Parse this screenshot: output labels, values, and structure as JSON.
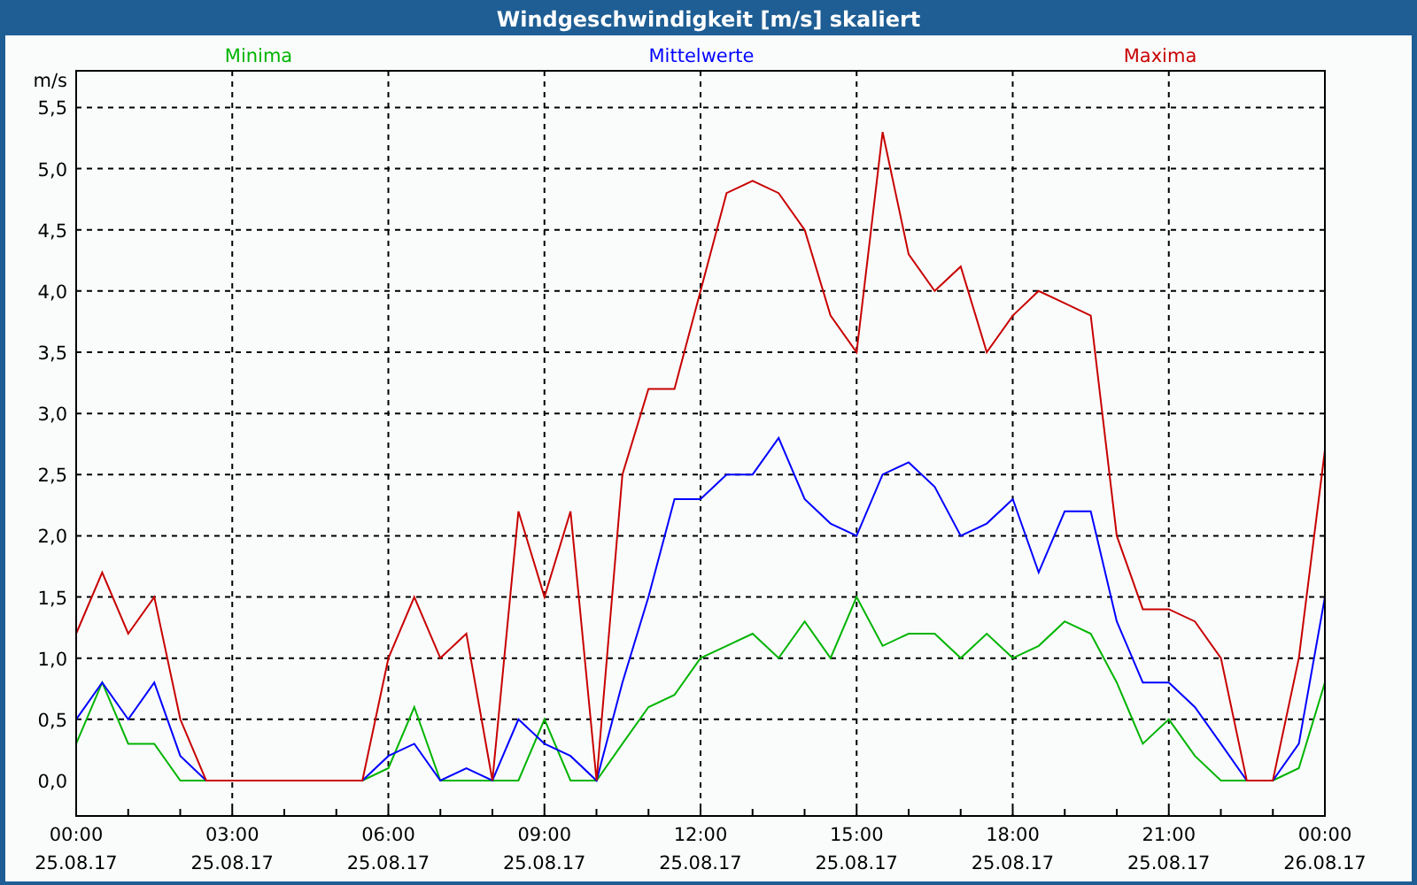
{
  "window": {
    "title": "Windgeschwindigkeit [m/s] skaliert"
  },
  "chart": {
    "chart_data": {
      "type": "line",
      "ylabel": "m/s",
      "categories": [
        "00:00\n25.08.17",
        null,
        null,
        null,
        null,
        null,
        "03:00\n25.08.17",
        null,
        null,
        null,
        null,
        null,
        "06:00\n25.08.17",
        null,
        null,
        null,
        null,
        null,
        "09:00\n25.08.17",
        null,
        null,
        null,
        null,
        null,
        "12:00\n25.08.17",
        null,
        null,
        null,
        null,
        null,
        "15:00\n25.08.17",
        null,
        null,
        null,
        null,
        null,
        "18:00\n25.08.17",
        null,
        null,
        null,
        null,
        null,
        "21:00\n25.08.17",
        null,
        null,
        null,
        null,
        null,
        "00:00\n26.08.17"
      ],
      "series": [
        {
          "name": "Minima",
          "color": "#00b400",
          "values": [
            0.3,
            0.8,
            0.3,
            0.3,
            0,
            0,
            0,
            0,
            0,
            0,
            0,
            0,
            0.1,
            0.6,
            0,
            0,
            0,
            0,
            0.5,
            0,
            0,
            0.3,
            0.6,
            0.7,
            1.0,
            1.1,
            1.2,
            1.0,
            1.3,
            1.0,
            1.5,
            1.1,
            1.2,
            1.2,
            1.0,
            1.2,
            1.0,
            1.1,
            1.3,
            1.2,
            0.8,
            0.3,
            0.5,
            0.2,
            0,
            0,
            0,
            0.1,
            0.8
          ]
        },
        {
          "name": "Mittelwerte",
          "color": "#0000ff",
          "values": [
            0.5,
            0.8,
            0.5,
            0.8,
            0.2,
            0,
            0,
            0,
            0,
            0,
            0,
            0,
            0.2,
            0.3,
            0,
            0.1,
            0,
            0.5,
            0.3,
            0.2,
            0,
            0.8,
            1.5,
            2.3,
            2.3,
            2.5,
            2.5,
            2.8,
            2.3,
            2.1,
            2.0,
            2.5,
            2.6,
            2.4,
            2.0,
            2.1,
            2.3,
            1.7,
            2.2,
            2.2,
            1.3,
            0.8,
            0.8,
            0.6,
            0.3,
            0,
            0,
            0.3,
            1.5
          ]
        },
        {
          "name": "Maxima",
          "color": "#c80000",
          "values": [
            1.2,
            1.7,
            1.2,
            1.5,
            0.5,
            0,
            0,
            0,
            0,
            0,
            0,
            0,
            1.0,
            1.5,
            1.0,
            1.2,
            0,
            2.2,
            1.5,
            2.2,
            0,
            2.5,
            3.2,
            3.2,
            4.0,
            4.8,
            4.9,
            4.8,
            4.5,
            3.8,
            3.5,
            5.3,
            4.3,
            4.0,
            4.2,
            3.5,
            3.8,
            4.0,
            3.9,
            3.8,
            2.0,
            1.4,
            1.4,
            1.3,
            1.0,
            0,
            0,
            1.0,
            2.7
          ]
        }
      ],
      "ylim": [
        -0.29,
        5.8
      ],
      "grid": true,
      "yticks": [
        {
          "value": 0,
          "label": "0,0"
        },
        {
          "value": 0.5,
          "label": "0,5"
        },
        {
          "value": 1,
          "label": "1,0"
        },
        {
          "value": 1.5,
          "label": "1,5"
        },
        {
          "value": 2,
          "label": "2,0"
        },
        {
          "value": 2.5,
          "label": "2,5"
        },
        {
          "value": 3,
          "label": "3,0"
        },
        {
          "value": 3.5,
          "label": "3,5"
        },
        {
          "value": 4,
          "label": "4,0"
        },
        {
          "value": 4.5,
          "label": "4,5"
        },
        {
          "value": 5,
          "label": "5,0"
        },
        {
          "value": 5.5,
          "label": "5,5"
        }
      ]
    }
  }
}
